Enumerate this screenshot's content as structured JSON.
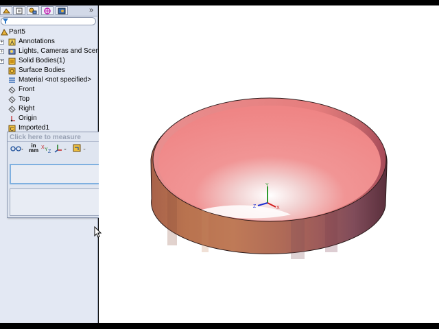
{
  "feature_tree": {
    "root": "Part5",
    "items": [
      {
        "label": "Annotations",
        "icon": "annotations-icon",
        "expandable": true
      },
      {
        "label": "Lights, Cameras and Scene",
        "icon": "lights-cameras-icon",
        "expandable": true
      },
      {
        "label": "Solid Bodies(1)",
        "icon": "solid-bodies-icon",
        "expandable": true
      },
      {
        "label": "Surface Bodies",
        "icon": "surface-bodies-icon",
        "expandable": false
      },
      {
        "label": "Material <not specified>",
        "icon": "material-icon",
        "expandable": false
      },
      {
        "label": "Front",
        "icon": "plane-icon",
        "expandable": false
      },
      {
        "label": "Top",
        "icon": "plane-icon",
        "expandable": false
      },
      {
        "label": "Right",
        "icon": "plane-icon",
        "expandable": false
      },
      {
        "label": "Origin",
        "icon": "origin-icon",
        "expandable": false
      },
      {
        "label": "Imported1",
        "icon": "imported-feature-icon",
        "expandable": false
      }
    ]
  },
  "panel_tabs": [
    "feature-manager-tab",
    "property-manager-tab",
    "configuration-manager-tab",
    "dimxpert-tab",
    "display-manager-tab"
  ],
  "more_tabs": "»",
  "measure": {
    "title": "Click here to measure",
    "close": "×",
    "units_top": "in",
    "units_bottom": "mm",
    "collapse": "⌃"
  },
  "triad": {
    "x": "X",
    "y": "Y",
    "z": "Z"
  },
  "colors": {
    "bowl_inner": "#f08a8a",
    "bowl_outer": "#b06c52",
    "panel_bg": "#e3e8f3"
  }
}
